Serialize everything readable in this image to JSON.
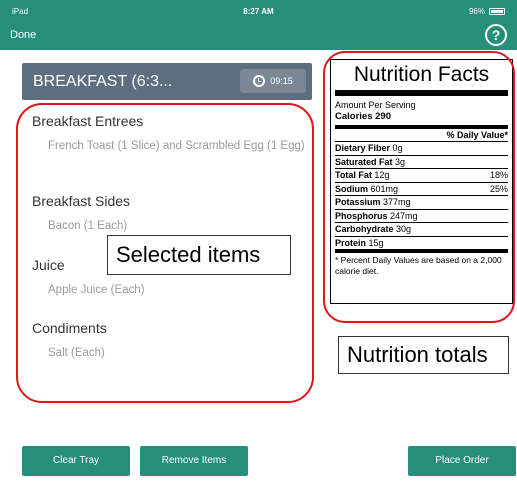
{
  "status_bar": {
    "carrier": "iPad",
    "time": "8:27 AM",
    "battery": "96%"
  },
  "nav": {
    "done_label": "Done",
    "help_label": "?"
  },
  "meal": {
    "title": "BREAKFAST (6:3...",
    "time": "09:15"
  },
  "categories": [
    {
      "name": "Breakfast Entrees",
      "item": "French Toast (1 Slice) and Scrambled Egg (1 Egg)"
    },
    {
      "name": "Breakfast Sides",
      "item": "Bacon (1 Each)"
    },
    {
      "name": "Juice",
      "item": "Apple Juice (Each)"
    },
    {
      "name": "Condiments",
      "item": "Salt (Each)"
    }
  ],
  "callouts": {
    "selected": "Selected items",
    "totals": "Nutrition totals"
  },
  "nutrition": {
    "title": "Nutrition Facts",
    "amount_per_serving": "Amount Per Serving",
    "calories": "Calories 290",
    "dv_header": "% Daily Value*",
    "rows": [
      {
        "name": "Dietary Fiber",
        "value": "0g",
        "dv": ""
      },
      {
        "name": "Saturated Fat",
        "value": "3g",
        "dv": ""
      },
      {
        "name": "Total Fat",
        "value": "12g",
        "dv": "18%"
      },
      {
        "name": "Sodium",
        "value": "601mg",
        "dv": "25%"
      },
      {
        "name": "Potassium",
        "value": "377mg",
        "dv": ""
      },
      {
        "name": "Phosphorus",
        "value": "247mg",
        "dv": ""
      },
      {
        "name": "Carbohydrate",
        "value": "30g",
        "dv": ""
      },
      {
        "name": "Protein",
        "value": "15g",
        "dv": ""
      }
    ],
    "footnote": "* Percent Daily Values are based on a 2,000 calorie diet."
  },
  "buttons": {
    "clear": "Clear Tray",
    "remove": "Remove Items",
    "place": "Place Order"
  },
  "colors": {
    "accent": "#268f7c",
    "header": "#5d6f7f",
    "highlight": "#e0161c"
  },
  "icons": {
    "help": "help-circle-icon",
    "clock": "clock-icon",
    "wifi": "wifi-icon",
    "battery": "battery-icon"
  }
}
